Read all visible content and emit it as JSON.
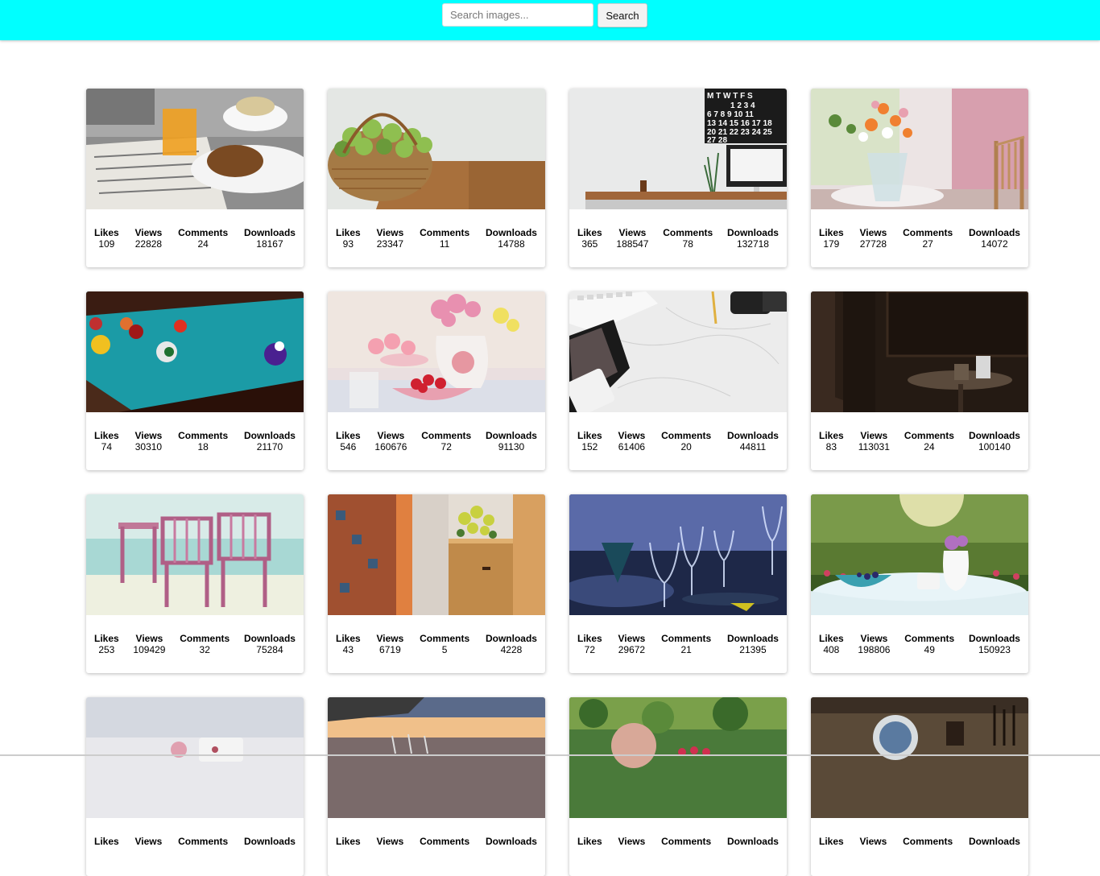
{
  "search": {
    "placeholder": "Search images...",
    "button_label": "Search"
  },
  "colors": {
    "topbar": "#00ffff"
  },
  "stat_labels": {
    "likes": "Likes",
    "views": "Views",
    "comments": "Comments",
    "downloads": "Downloads"
  },
  "gallery": [
    {
      "scene": "breakfast-newspaper",
      "likes": "109",
      "views": "22828",
      "comments": "24",
      "downloads": "18167"
    },
    {
      "scene": "apple-basket",
      "likes": "93",
      "views": "23347",
      "comments": "11",
      "downloads": "14788"
    },
    {
      "scene": "desk-calendar-computer",
      "likes": "365",
      "views": "188547",
      "comments": "78",
      "downloads": "132718"
    },
    {
      "scene": "flowers-window",
      "likes": "179",
      "views": "27728",
      "comments": "27",
      "downloads": "14072"
    },
    {
      "scene": "billiard-table",
      "likes": "74",
      "views": "30310",
      "comments": "18",
      "downloads": "21170"
    },
    {
      "scene": "strawberries-flowers",
      "likes": "546",
      "views": "160676",
      "comments": "72",
      "downloads": "91130"
    },
    {
      "scene": "marble-desk",
      "likes": "152",
      "views": "61406",
      "comments": "20",
      "downloads": "44811"
    },
    {
      "scene": "cafe-table-dark",
      "likes": "83",
      "views": "113031",
      "comments": "24",
      "downloads": "100140"
    },
    {
      "scene": "beach-chairs",
      "likes": "253",
      "views": "109429",
      "comments": "32",
      "downloads": "75284"
    },
    {
      "scene": "yellow-flowers-wood",
      "likes": "43",
      "views": "6719",
      "comments": "5",
      "downloads": "4228"
    },
    {
      "scene": "wine-glasses-blue",
      "likes": "72",
      "views": "29672",
      "comments": "21",
      "downloads": "21395"
    },
    {
      "scene": "garden-table",
      "likes": "408",
      "views": "198806",
      "comments": "49",
      "downloads": "150923"
    },
    {
      "scene": "teacup-table",
      "likes": "",
      "views": "",
      "comments": "",
      "downloads": ""
    },
    {
      "scene": "sunset-glasses",
      "likes": "",
      "views": "",
      "comments": "",
      "downloads": ""
    },
    {
      "scene": "garden-plants",
      "likes": "",
      "views": "",
      "comments": "",
      "downloads": ""
    },
    {
      "scene": "globe-lamp",
      "likes": "",
      "views": "",
      "comments": "",
      "downloads": ""
    }
  ]
}
